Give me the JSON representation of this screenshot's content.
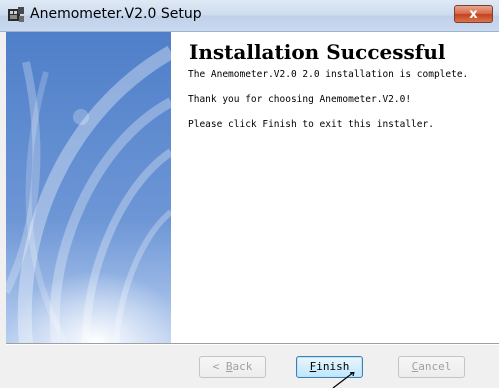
{
  "window": {
    "title": "Anemometer.V2.0 Setup",
    "close_label": "x"
  },
  "content": {
    "heading": "Installation Successful",
    "line1": "The Anemometer.V2.0 2.0 installation is complete.",
    "line2": "Thank you for choosing Anemometer.V2.0!",
    "line3": "Please click Finish to exit this installer."
  },
  "buttons": {
    "back": {
      "mnemonic": "B",
      "rest": "ack",
      "prefix": "< "
    },
    "finish": {
      "mnemonic": "F",
      "rest": "inish"
    },
    "cancel": {
      "mnemonic": "C",
      "rest": "ancel"
    }
  },
  "colors": {
    "side_panel": "#5e88cc",
    "title_bar": "#cddcef",
    "close_button": "#c5401c"
  }
}
